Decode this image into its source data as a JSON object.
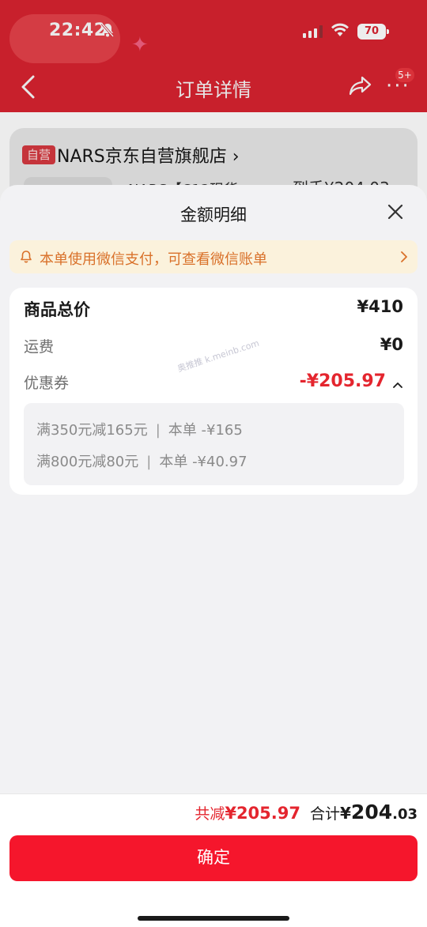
{
  "status_bar": {
    "time": "22:42",
    "battery": "70"
  },
  "nav": {
    "title": "订单详情",
    "badge": "5+"
  },
  "background": {
    "store_tag": "自营",
    "store_name": "NARS京东自营旗舰店",
    "product_name_partial": "NARS【C12现货",
    "price_partial": "到手¥204.03"
  },
  "sheet": {
    "title": "金额明细",
    "notice": "本单使用微信支付，可查看微信账单",
    "rows": {
      "total": {
        "label": "商品总价",
        "value": "¥410"
      },
      "shipping": {
        "label": "运费",
        "value": "¥0"
      },
      "coupon": {
        "label": "优惠券",
        "value": "-¥205.97"
      }
    },
    "coupons": [
      {
        "rule": "满350元减165元",
        "amount": "本单 -¥165"
      },
      {
        "rule": "满800元减80元",
        "amount": "本单 -¥40.97"
      }
    ],
    "watermark": "奥推推 k.meinb.com"
  },
  "footer": {
    "reduce_label": "共减",
    "reduce_amount": "¥205.97",
    "total_label": "合计",
    "total_yen": "¥",
    "total_int": "204",
    "total_dec": ".03",
    "confirm": "确定"
  },
  "colors": {
    "accent": "#f5162c",
    "discount": "#e4252e",
    "notice_text": "#d9712a",
    "notice_bg": "#fbf2dc"
  }
}
